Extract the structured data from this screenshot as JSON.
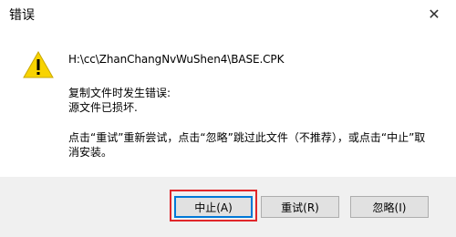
{
  "window": {
    "title": "错误",
    "close_glyph": "✕"
  },
  "content": {
    "icon": "warning-icon",
    "file_path": "H:\\cc\\ZhanChangNvWuShen4\\BASE.CPK",
    "message_line1": "复制文件时发生错误:",
    "message_line2": "源文件已损坏.",
    "instructions": "点击“重试”重新尝试，点击“忽略”跳过此文件（不推荐），或点击“中止”取消安装。"
  },
  "buttons": {
    "abort": "中止(A)",
    "retry": "重试(R)",
    "ignore": "忽略(I)"
  },
  "colors": {
    "highlight": "#e0262a",
    "default_button_border": "#0078d7",
    "warning_fill": "#f8d300"
  }
}
